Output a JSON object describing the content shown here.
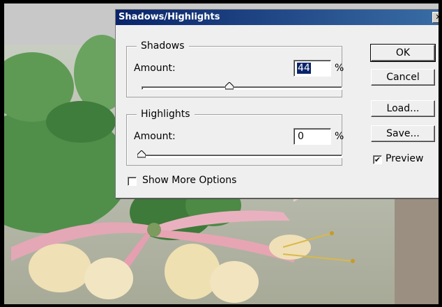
{
  "dialog": {
    "title": "Shadows/Highlights",
    "close_glyph": "✕"
  },
  "shadows": {
    "group_label": "Shadows",
    "amount_label": "Amount:",
    "amount_value": "44",
    "unit": "%",
    "slider_value": 44
  },
  "highlights": {
    "group_label": "Highlights",
    "amount_label": "Amount:",
    "amount_value": "0",
    "unit": "%",
    "slider_value": 0
  },
  "buttons": {
    "ok": "OK",
    "cancel": "Cancel",
    "load": "Load...",
    "save": "Save..."
  },
  "preview": {
    "label": "Preview",
    "checked": true,
    "check_glyph": "✔"
  },
  "show_more": {
    "label": "Show More Options",
    "checked": false
  }
}
